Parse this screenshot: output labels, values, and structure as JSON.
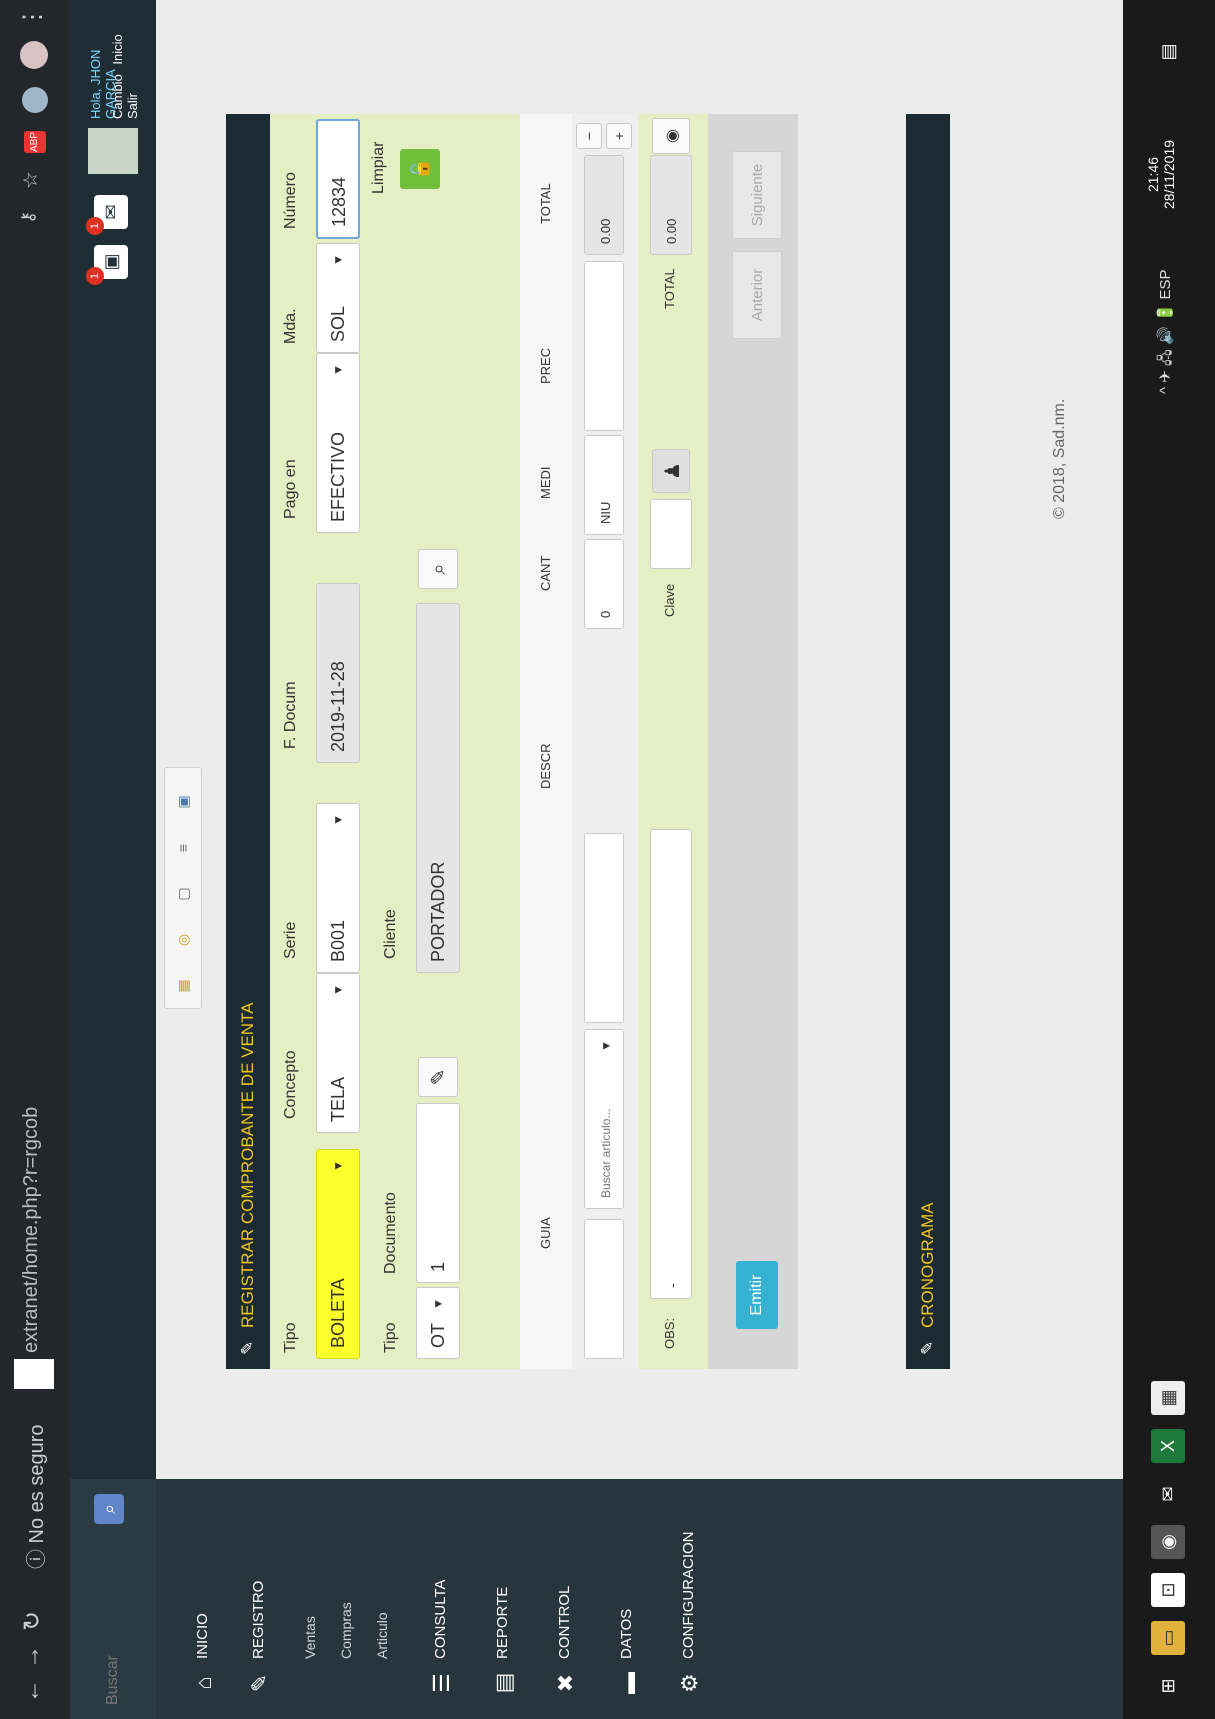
{
  "browser": {
    "nav_icons": [
      "back-arrow-icon",
      "forward-arrow-icon",
      "reload-icon"
    ],
    "security_text": "No es seguro",
    "url": "extranet/home.php?r=rgcob",
    "right_icons": [
      "key-icon",
      "star-icon",
      "extension-icon",
      "profile-icon",
      "menu-dots-icon"
    ]
  },
  "header": {
    "search_placeholder": "Buscar",
    "notifications_badge": "1",
    "messages_badge": "1",
    "user_greeting": "Hola, JHON GARCIA",
    "user_links": [
      "Cambio",
      "Inicio",
      "Salir"
    ]
  },
  "sidebar": {
    "items": [
      {
        "label": "INICIO",
        "icon": "home-icon"
      },
      {
        "label": "REGISTRO",
        "icon": "pencil-icon"
      },
      {
        "label": "CONSULTA",
        "icon": "list-icon"
      },
      {
        "label": "REPORTE",
        "icon": "report-icon"
      },
      {
        "label": "CONTROL",
        "icon": "tools-icon"
      },
      {
        "label": "DATOS",
        "icon": "folder-icon"
      },
      {
        "label": "CONFIGURACION",
        "icon": "gears-icon"
      }
    ],
    "registro_sub": [
      "Ventas",
      "Compras",
      "Articulo"
    ]
  },
  "panel": {
    "title": "REGISTRAR COMPROBANTE DE VENTA",
    "toolbar_icons": [
      "excel-icon",
      "coins-icon",
      "document-icon",
      "list-icon",
      "image-icon"
    ],
    "fields": {
      "tipo_label": "Tipo",
      "tipo_value": "BOLETA",
      "concepto_label": "Concepto",
      "concepto_value": "TELA",
      "serie_label": "Serie",
      "serie_value": "B001",
      "fdocum_label": "F. Docum",
      "fdocum_value": "2019-11-28",
      "pago_label": "Pago en",
      "pago_value": "EFECTIVO",
      "mda_label": "Mda.",
      "mda_value": "SOL",
      "numero_label": "Número",
      "numero_value": "12834",
      "limpiar_label": "Limpiar",
      "tipo2_label": "Tipo",
      "tipo2_value": "OT",
      "documento_label": "Documento",
      "documento_value": "1",
      "cliente_label": "Cliente",
      "cliente_value": "PORTADOR"
    },
    "columns": [
      "GUIA",
      "DESCR",
      "CANT",
      "MEDI",
      "PREC",
      "TOTAL"
    ],
    "item_row": {
      "search_placeholder": "Buscar articulo...",
      "cant": "0",
      "medi": "NIU",
      "total": "0.00"
    },
    "totals": {
      "obs_label": "OBS:",
      "obs_value": "-",
      "clave_label": "Clave",
      "total_label": "TOTAL",
      "total_value": "0.00"
    },
    "buttons": {
      "emit": "Emitir",
      "anterior": "Anterior",
      "siguiente": "Siguiente"
    }
  },
  "cronograma": {
    "title": "CRONOGRAMA"
  },
  "copyright": "© 2018, Sad.nm.",
  "taskbar": {
    "systray": "^ ✈ 🖧 🔊 🔋 ESP",
    "time": "21:46",
    "date": "28/11/2019"
  }
}
